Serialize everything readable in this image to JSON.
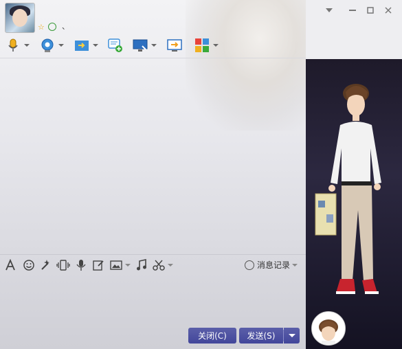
{
  "title": {
    "name": "、"
  },
  "toolbar_top": {
    "items": [
      "microphone-icon",
      "webcam-icon",
      "send-file-icon",
      "new-message-icon",
      "remote-desktop-icon",
      "share-screen-icon",
      "apps-icon"
    ]
  },
  "toolbar_bottom": {
    "items": [
      "font-icon",
      "emoji-icon",
      "magic-icon",
      "vibrate-icon",
      "voice-icon",
      "edit-icon",
      "image-icon",
      "music-icon",
      "scissors-icon"
    ],
    "history_label": "消息记录"
  },
  "buttons": {
    "close": "关闭(C)",
    "send": "发送(S)"
  },
  "colors": {
    "button_bg": "#4a4e9f",
    "panel_dark": "#1e1a2a"
  }
}
